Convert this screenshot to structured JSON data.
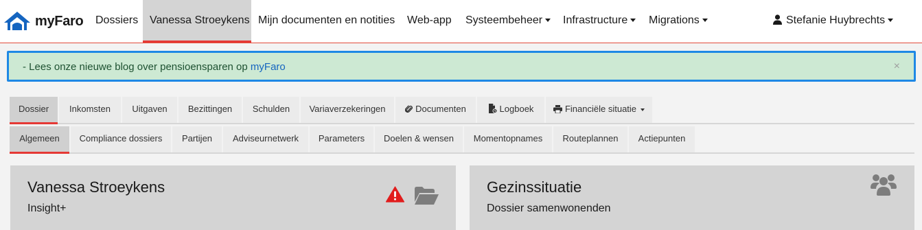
{
  "navbar": {
    "brand": "myFaro",
    "items": [
      {
        "label": "Dossiers"
      },
      {
        "label": "Vanessa Stroeykens",
        "active": true
      },
      {
        "label": "Mijn documenten en notities"
      },
      {
        "label": "Web-app"
      },
      {
        "label": "Systeembeheer",
        "dropdown": true
      },
      {
        "label": "Infrastructure",
        "dropdown": true
      },
      {
        "label": "Migrations",
        "dropdown": true
      }
    ],
    "user": "Stefanie Huybrechts"
  },
  "alert": {
    "text": "- Lees onze nieuwe blog over pensioensparen op ",
    "link": "myFaro",
    "close": "×"
  },
  "tabs_primary": [
    {
      "label": "Dossier",
      "active": true
    },
    {
      "label": "Inkomsten"
    },
    {
      "label": "Uitgaven"
    },
    {
      "label": "Bezittingen"
    },
    {
      "label": "Schulden"
    },
    {
      "label": "Variaverzekeringen"
    },
    {
      "label": "Documenten",
      "icon": "paperclip-icon"
    },
    {
      "label": "Logboek",
      "icon": "file-icon"
    },
    {
      "label": "Financiële situatie",
      "icon": "printer-icon",
      "dropdown": true
    }
  ],
  "tabs_secondary": [
    {
      "label": "Algemeen",
      "active": true
    },
    {
      "label": "Compliance dossiers"
    },
    {
      "label": "Partijen"
    },
    {
      "label": "Adviseurnetwerk"
    },
    {
      "label": "Parameters"
    },
    {
      "label": "Doelen & wensen"
    },
    {
      "label": "Momentopnames"
    },
    {
      "label": "Routeplannen"
    },
    {
      "label": "Actiepunten"
    }
  ],
  "cards": {
    "client": {
      "title": "Vanessa Stroeykens",
      "subtitle": "Insight+",
      "icons": [
        "warning-icon",
        "folder-open-icon"
      ]
    },
    "family": {
      "title": "Gezinssituatie",
      "subtitle": "Dossier samenwonenden",
      "icons": [
        "users-icon"
      ]
    }
  },
  "colors": {
    "accent": "#e53935",
    "alert_bg": "#cde9d3",
    "alert_border": "#1e88e5",
    "brand_blue": "#1565c0",
    "warning": "#e11d1d"
  }
}
